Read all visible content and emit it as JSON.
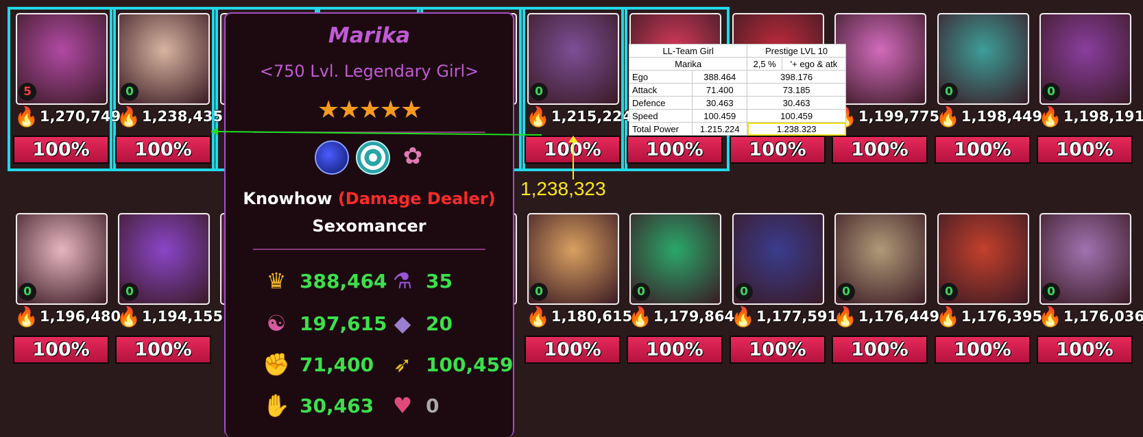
{
  "grid": {
    "row1": [
      {
        "level": "5",
        "level_color": "red",
        "power": "1,270,749",
        "pct": "100%",
        "art": "#b14aa4"
      },
      {
        "level": "0",
        "power": "1,238,435",
        "pct": "100%",
        "art": "#d8b4a0"
      },
      {
        "level": "",
        "power": "",
        "pct": "",
        "art": "#7d4e64"
      },
      {
        "level": "",
        "power": "",
        "pct": "",
        "art": "#7d4e64"
      },
      {
        "level": "",
        "power": "",
        "pct": "",
        "art": "#7d4e64"
      },
      {
        "level": "0",
        "power": "1,215,224",
        "pct": "100%",
        "art": "#7c4f96"
      },
      {
        "level": "",
        "power": "",
        "pct": "100%",
        "art": "#d63a5a"
      },
      {
        "level": "",
        "power": "",
        "pct": "100%",
        "art": "#c22b3a"
      },
      {
        "level": "",
        "power": "1,199,775",
        "pct": "100%",
        "art": "#d26bbd"
      },
      {
        "level": "0",
        "power": "1,198,449",
        "pct": "100%",
        "art": "#3d9e99"
      },
      {
        "level": "0",
        "power": "1,198,191",
        "pct": "100%",
        "art": "#8a3e9e"
      }
    ],
    "row2": [
      {
        "level": "0",
        "power": "1,196,480",
        "pct": "100%",
        "art": "#e6b6c0"
      },
      {
        "level": "0",
        "power": "1,194,155",
        "pct": "100%",
        "art": "#8a46c8"
      },
      {
        "level": "",
        "power": "",
        "pct": "",
        "art": "#7d4e64"
      },
      {
        "level": "",
        "power": "",
        "pct": "",
        "art": "#7d4e64"
      },
      {
        "level": "",
        "power": "",
        "pct": "",
        "art": "#7d4e64"
      },
      {
        "level": "0",
        "power": "1,180,615",
        "pct": "100%",
        "art": "#d9a060"
      },
      {
        "level": "0",
        "power": "1,179,864",
        "pct": "100%",
        "art": "#2aa86a"
      },
      {
        "level": "0",
        "power": "1,177,591",
        "pct": "100%",
        "art": "#3a3c8e"
      },
      {
        "level": "0",
        "power": "1,176,449",
        "pct": "100%",
        "art": "#b09a78"
      },
      {
        "level": "0",
        "power": "1,176,395",
        "pct": "100%",
        "art": "#c3402c"
      },
      {
        "level": "0",
        "power": "1,176,036",
        "pct": "100%",
        "art": "#a073b0"
      }
    ]
  },
  "tooltip": {
    "name": "Marika",
    "subtitle": "<750 Lvl. Legendary Girl>",
    "stars": "★★★★★",
    "class_name": "Knowhow",
    "class_role": "(Damage Dealer)",
    "role": "Sexomancer",
    "stats": [
      {
        "icon": "crown-icon",
        "glyph": "♛",
        "value": "388,464"
      },
      {
        "icon": "potion-icon",
        "glyph": "⚗",
        "value": "35"
      },
      {
        "icon": "yin-yang-icon",
        "glyph": "☯",
        "value": "197,615"
      },
      {
        "icon": "crystal-icon",
        "glyph": "◆",
        "value": "20"
      },
      {
        "icon": "attack-icon",
        "glyph": "✊",
        "value": "71,400"
      },
      {
        "icon": "speed-icon",
        "glyph": "➶",
        "value": "100,459"
      },
      {
        "icon": "defence-icon",
        "glyph": "✋",
        "value": "30,463"
      },
      {
        "icon": "heart-icon",
        "glyph": "♥",
        "value": "0"
      }
    ]
  },
  "overlay_table": {
    "header": [
      "LL-Team  Girl",
      "Prestige LVL 10"
    ],
    "subheader": [
      "Marika",
      "2,5 %",
      "'+ ego & atk"
    ],
    "rows": [
      [
        "Ego",
        "388.464",
        "398.176"
      ],
      [
        "Attack",
        "71.400",
        "73.185"
      ],
      [
        "Defence",
        "30.463",
        "30.463"
      ],
      [
        "Speed",
        "100.459",
        "100.459"
      ],
      [
        "Total Power",
        "1.215.224",
        "1.238.323"
      ]
    ]
  },
  "annotation": {
    "big_number": "1,238,323"
  }
}
